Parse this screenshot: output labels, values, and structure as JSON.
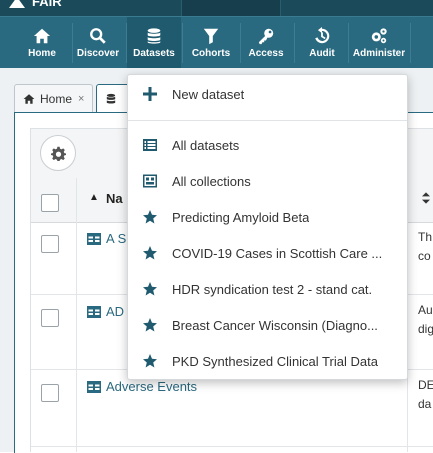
{
  "brand": {
    "text": "FAIR"
  },
  "nav": {
    "items": [
      {
        "label": "Home",
        "icon": "home-icon"
      },
      {
        "label": "Discover",
        "icon": "search-icon"
      },
      {
        "label": "Datasets",
        "icon": "database-icon"
      },
      {
        "label": "Cohorts",
        "icon": "filter-icon"
      },
      {
        "label": "Access",
        "icon": "key-icon"
      },
      {
        "label": "Audit",
        "icon": "history-icon"
      },
      {
        "label": "Administer",
        "icon": "cogs-icon"
      }
    ]
  },
  "tabs": [
    {
      "label": "Home",
      "icon": "home-icon",
      "close": "×"
    }
  ],
  "table": {
    "header_name": "Na",
    "header_sort_indicator": "▲",
    "rows": [
      {
        "name": "A S",
        "desc_line1": "Th",
        "desc_line2": "co"
      },
      {
        "name": "AD",
        "desc_line1": "Au",
        "desc_line2": "dig"
      },
      {
        "name": "Adverse Events",
        "desc_line1": "DE",
        "desc_line2": "da"
      }
    ]
  },
  "datasets_menu": {
    "new_dataset": "New dataset",
    "items": [
      {
        "label": "All datasets",
        "icon": "list-icon"
      },
      {
        "label": "All collections",
        "icon": "collection-icon"
      },
      {
        "label": "Predicting Amyloid Beta",
        "icon": "star-icon"
      },
      {
        "label": "COVID-19 Cases in Scottish Care ...",
        "icon": "star-icon"
      },
      {
        "label": "HDR syndication test 2 - stand cat.",
        "icon": "star-icon"
      },
      {
        "label": "Breast Cancer Wisconsin (Diagno...",
        "icon": "star-icon"
      },
      {
        "label": "PKD Synthesized Clinical Trial Data",
        "icon": "star-icon"
      }
    ]
  },
  "colors": {
    "nav_bg": "#2a6a80",
    "accent": "#1f5a6e",
    "link": "#2a6a80"
  }
}
